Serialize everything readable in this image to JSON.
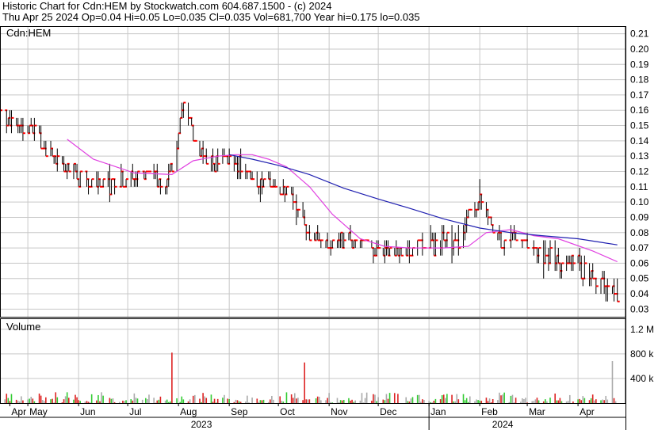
{
  "header": {
    "line1": "Historic Chart for Cdn:HEM by Stockwatch.com 604.687.1500 - (c) 2024",
    "line2": "Thu Apr 25 2024  Op=0.04  Hi=0.05  Lo=0.035  Cl=0.035  Vol=681,700  Year hi=0.175  lo=0.035"
  },
  "colors": {
    "price_bar": "#000000",
    "close_tick": "#ff0000",
    "ma_short": "#e040e0",
    "ma_long": "#1f1fb0",
    "vol_up": "#33cc33",
    "vol_down": "#dd2222",
    "vol_flat": "#aaaaaa",
    "grid": "#c8c8c8"
  },
  "chart_data": {
    "type": "line",
    "panels": [
      {
        "name": "price",
        "label": "Cdn:HEM",
        "ylim": [
          0.025,
          0.215
        ],
        "yticks": [
          0.03,
          0.04,
          0.05,
          0.06,
          0.07,
          0.08,
          0.09,
          0.1,
          0.11,
          0.12,
          0.13,
          0.14,
          0.15,
          0.16,
          0.17,
          0.18,
          0.19,
          0.2,
          0.21
        ],
        "ytick_labels": [
          "0.03",
          "0.04",
          "0.05",
          "0.06",
          "0.07",
          "0.08",
          "0.09",
          "0.10",
          "0.11",
          "0.12",
          "0.13",
          "0.14",
          "0.15",
          "0.16",
          "0.17",
          "0.18",
          "0.19",
          "0.20",
          "0.21"
        ],
        "grid": true
      },
      {
        "name": "volume",
        "label": "Volume",
        "ylim": [
          0,
          1300000
        ],
        "yticks": [
          400000,
          800000,
          1200000
        ],
        "ytick_labels": [
          "400 k",
          "800 k",
          "1.2 M"
        ],
        "grid": true
      }
    ],
    "x_month_ticks": [
      {
        "label": "Apr",
        "date": "2023-04-20"
      },
      {
        "label": "May",
        "date": "2023-05-01"
      },
      {
        "label": "Jun",
        "date": "2023-06-01"
      },
      {
        "label": "Jul",
        "date": "2023-07-01"
      },
      {
        "label": "Aug",
        "date": "2023-08-01"
      },
      {
        "label": "Sep",
        "date": "2023-09-01"
      },
      {
        "label": "Oct",
        "date": "2023-10-01"
      },
      {
        "label": "Nov",
        "date": "2023-11-01"
      },
      {
        "label": "Dec",
        "date": "2023-12-01"
      },
      {
        "label": "Jan",
        "date": "2024-01-01"
      },
      {
        "label": "Feb",
        "date": "2024-02-01"
      },
      {
        "label": "Mar",
        "date": "2024-03-01"
      },
      {
        "label": "Apr",
        "date": "2024-04-01"
      }
    ],
    "x_year_labels": [
      {
        "label": "2023",
        "date": "2023-08-15"
      },
      {
        "label": "2024",
        "date": "2024-02-15"
      }
    ],
    "year_divider": "2024-01-01",
    "x_range": [
      "2023-04-14",
      "2024-04-30"
    ],
    "price_waypoints": [
      [
        "2023-04-14",
        0.16
      ],
      [
        "2023-04-22",
        0.15
      ],
      [
        "2023-05-03",
        0.15
      ],
      [
        "2023-05-10",
        0.135
      ],
      [
        "2023-05-20",
        0.125
      ],
      [
        "2023-06-01",
        0.115
      ],
      [
        "2023-06-15",
        0.11
      ],
      [
        "2023-07-01",
        0.115
      ],
      [
        "2023-07-15",
        0.118
      ],
      [
        "2023-07-24",
        0.11
      ],
      [
        "2023-07-31",
        0.135
      ],
      [
        "2023-08-04",
        0.165
      ],
      [
        "2023-08-09",
        0.148
      ],
      [
        "2023-08-15",
        0.13
      ],
      [
        "2023-08-25",
        0.125
      ],
      [
        "2023-09-07",
        0.125
      ],
      [
        "2023-09-14",
        0.118
      ],
      [
        "2023-09-22",
        0.112
      ],
      [
        "2023-10-04",
        0.11
      ],
      [
        "2023-10-13",
        0.095
      ],
      [
        "2023-10-20",
        0.075
      ],
      [
        "2023-11-10",
        0.075
      ],
      [
        "2023-11-20",
        0.07
      ],
      [
        "2023-12-01",
        0.07
      ],
      [
        "2023-12-15",
        0.068
      ],
      [
        "2024-01-01",
        0.072
      ],
      [
        "2024-01-14",
        0.075
      ],
      [
        "2024-01-21",
        0.072
      ],
      [
        "2024-01-26",
        0.095
      ],
      [
        "2024-02-02",
        0.1
      ],
      [
        "2024-02-08",
        0.085
      ],
      [
        "2024-02-14",
        0.072
      ],
      [
        "2024-02-22",
        0.08
      ],
      [
        "2024-02-29",
        0.073
      ],
      [
        "2024-03-07",
        0.065
      ],
      [
        "2024-03-14",
        0.063
      ],
      [
        "2024-03-21",
        0.06
      ],
      [
        "2024-03-30",
        0.06
      ],
      [
        "2024-04-05",
        0.055
      ],
      [
        "2024-04-12",
        0.048
      ],
      [
        "2024-04-18",
        0.05
      ],
      [
        "2024-04-25",
        0.035
      ]
    ],
    "series": [
      {
        "name": "ma_short",
        "x": [
          "2023-05-25",
          "2023-06-10",
          "2023-07-05",
          "2023-07-28",
          "2023-08-10",
          "2023-08-25",
          "2023-09-05",
          "2023-09-15",
          "2023-09-25",
          "2023-10-06",
          "2023-10-20",
          "2023-11-03",
          "2023-11-20",
          "2023-12-05",
          "2023-12-20",
          "2024-01-10",
          "2024-01-25",
          "2024-02-05",
          "2024-02-20",
          "2024-03-05",
          "2024-03-20",
          "2024-04-10",
          "2024-04-25"
        ],
        "values": [
          0.141,
          0.128,
          0.119,
          0.118,
          0.127,
          0.13,
          0.131,
          0.131,
          0.128,
          0.123,
          0.11,
          0.092,
          0.076,
          0.071,
          0.07,
          0.07,
          0.071,
          0.08,
          0.082,
          0.078,
          0.076,
          0.068,
          0.061
        ]
      },
      {
        "name": "ma_long",
        "x": [
          "2023-09-01",
          "2023-09-15",
          "2023-10-01",
          "2023-10-20",
          "2023-11-10",
          "2023-12-01",
          "2023-12-20",
          "2024-01-10",
          "2024-02-01",
          "2024-02-20",
          "2024-03-10",
          "2024-04-01",
          "2024-04-25"
        ],
        "values": [
          0.131,
          0.128,
          0.124,
          0.118,
          0.109,
          0.102,
          0.096,
          0.089,
          0.083,
          0.08,
          0.078,
          0.076,
          0.072
        ]
      }
    ],
    "volume_notable": [
      [
        "2023-07-28",
        820000
      ],
      [
        "2023-10-17",
        660000
      ],
      [
        "2024-03-16",
        420000
      ],
      [
        "2024-04-21",
        1220000
      ],
      [
        "2024-04-22",
        681700
      ]
    ],
    "last": {
      "open": 0.04,
      "high": 0.05,
      "low": 0.035,
      "close": 0.035,
      "volume": 681700,
      "date": "2024-04-25"
    }
  }
}
